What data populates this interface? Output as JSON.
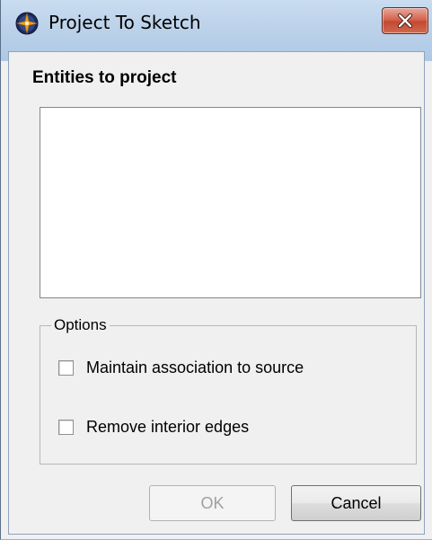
{
  "window": {
    "title": "Project To Sketch",
    "app_icon": "compass-star-icon",
    "close_icon": "close-x-icon"
  },
  "entities": {
    "heading": "Entities to project",
    "items": []
  },
  "options": {
    "legend": "Options",
    "maintain_association": {
      "label": "Maintain association  to source",
      "checked": false
    },
    "remove_interior_edges": {
      "label": "Remove interior edges",
      "checked": false
    }
  },
  "buttons": {
    "ok_label": "OK",
    "ok_enabled": false,
    "cancel_label": "Cancel"
  },
  "colors": {
    "titlebar": "#bcd2ea",
    "close_button": "#c9533c",
    "dialog_background": "#f0f0f0",
    "disabled_text": "#a0a0a0"
  }
}
